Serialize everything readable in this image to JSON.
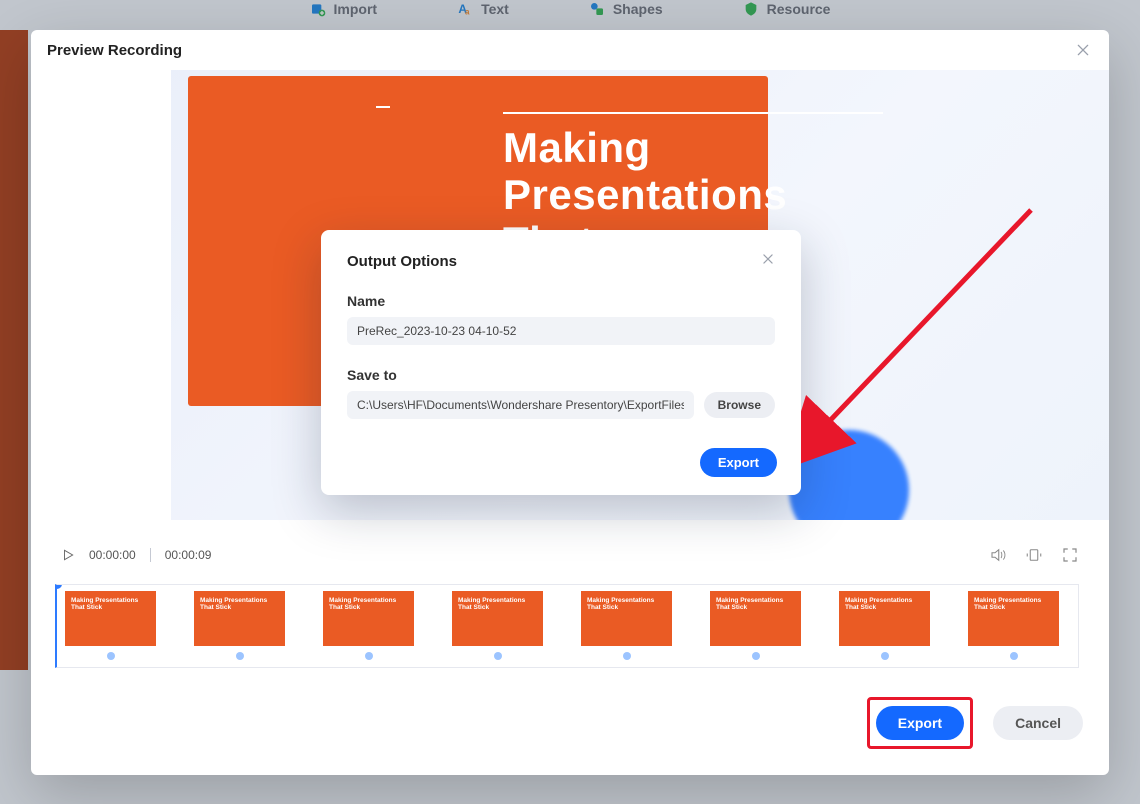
{
  "topbar": {
    "import": "Import",
    "text": "Text",
    "shapes": "Shapes",
    "resource": "Resource"
  },
  "preview": {
    "title": "Preview Recording",
    "slide_title": "Making Presentations That",
    "current_time": "00:00:00",
    "total_time": "00:00:09",
    "export_label": "Export",
    "cancel_label": "Cancel"
  },
  "timeline": {
    "thumb_title": "Making Presentations That Stick",
    "thumb_sub": ""
  },
  "output": {
    "dialog_title": "Output Options",
    "name_label": "Name",
    "name_value": "PreRec_2023-10-23 04-10-52",
    "save_label": "Save to",
    "save_value": "C:\\Users\\HF\\Documents\\Wondershare Presentory\\ExportFiles",
    "browse_label": "Browse",
    "export_label": "Export"
  }
}
